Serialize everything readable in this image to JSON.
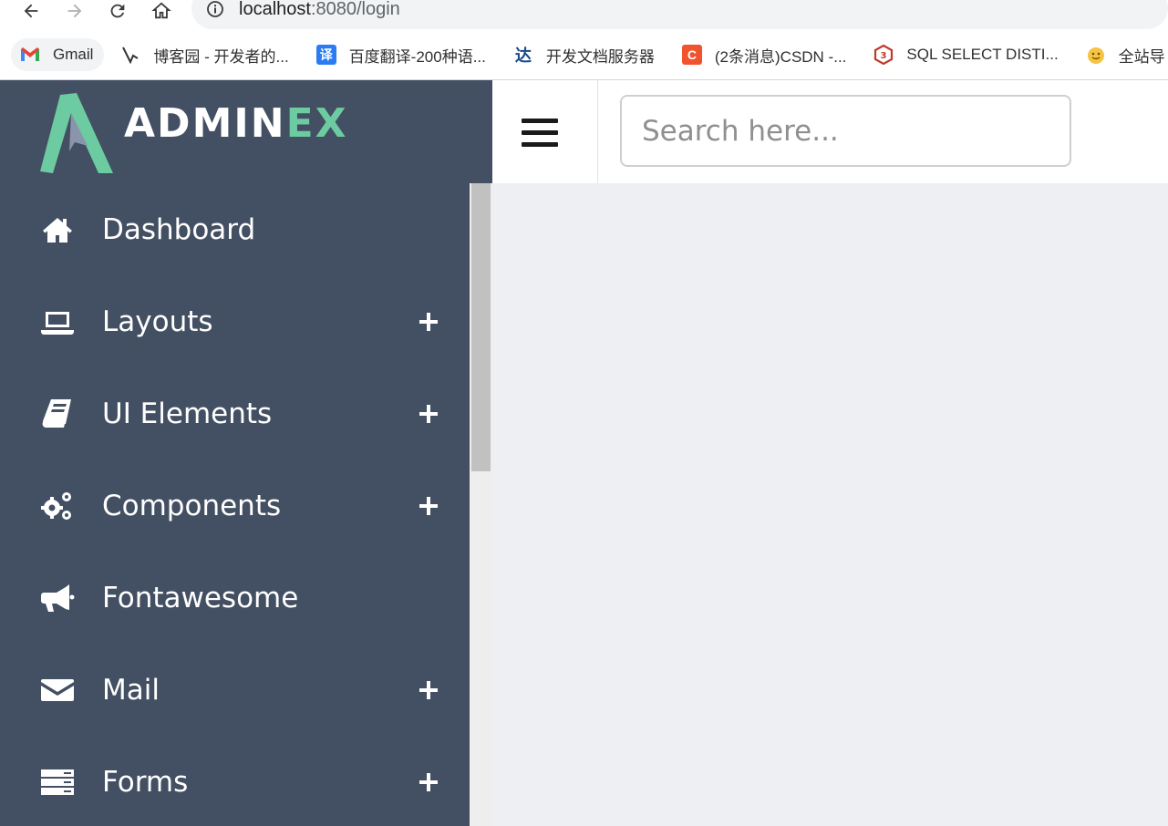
{
  "browser": {
    "url_host": "localhost",
    "url_rest": ":8080/login",
    "bookmarks": [
      {
        "label": "Gmail",
        "icon": "gmail-icon"
      },
      {
        "label": "博客园 - 开发者的...",
        "icon": "cnblogs-icon"
      },
      {
        "label": "百度翻译-200种语...",
        "icon": "baidu-translate-icon",
        "badge": "译"
      },
      {
        "label": "开发文档服务器",
        "icon": "devdocs-icon",
        "badge": "达"
      },
      {
        "label": "(2条消息)CSDN -...",
        "icon": "csdn-icon",
        "badge": "C"
      },
      {
        "label": "SQL SELECT DISTI...",
        "icon": "w3school-icon"
      },
      {
        "label": "全站导",
        "icon": "smiley-icon"
      }
    ]
  },
  "brand": {
    "name_part1": "ADMIN",
    "name_part2": "EX",
    "colors": {
      "accent": "#6ccba1",
      "sidebar": "#434f62"
    }
  },
  "menu": [
    {
      "label": "Dashboard",
      "icon": "home-icon",
      "expandable": false
    },
    {
      "label": "Layouts",
      "icon": "laptop-icon",
      "expandable": true
    },
    {
      "label": "UI Elements",
      "icon": "book-icon",
      "expandable": true
    },
    {
      "label": "Components",
      "icon": "cogs-icon",
      "expandable": true
    },
    {
      "label": "Fontawesome",
      "icon": "bullhorn-icon",
      "expandable": false
    },
    {
      "label": "Mail",
      "icon": "envelope-icon",
      "expandable": true
    },
    {
      "label": "Forms",
      "icon": "server-icon",
      "expandable": true
    }
  ],
  "header": {
    "search_placeholder": "Search here..."
  }
}
